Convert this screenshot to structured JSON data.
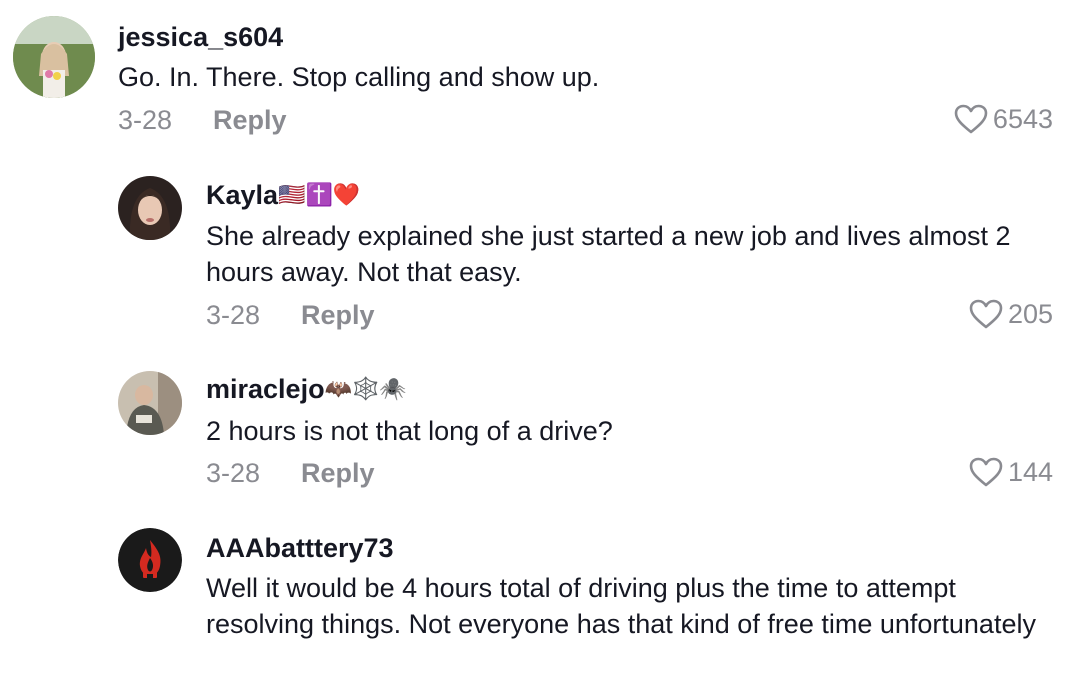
{
  "comments": [
    {
      "username": "jessica_s604",
      "emoji": "",
      "text": "Go. In. There. Stop calling and show up.",
      "date": "3-28",
      "reply_label": "Reply",
      "likes": "6543",
      "avatar_icon": "profile-photo-outdoor"
    },
    {
      "username": "Kayla",
      "emoji": "🇺🇸✝️❤️",
      "text": "She already explained she just started a new job and lives almost 2 hours away. Not that easy.",
      "date": "3-28",
      "reply_label": "Reply",
      "likes": "205",
      "avatar_icon": "profile-photo-portrait"
    },
    {
      "username": "miraclejo",
      "emoji": "🦇🕸️🕷️",
      "text": "2 hours is not that long of a drive?",
      "date": "3-28",
      "reply_label": "Reply",
      "likes": "144",
      "avatar_icon": "profile-photo-mirror"
    },
    {
      "username": "AAAbatttery73",
      "emoji": "",
      "text": "Well it would be 4 hours total of driving plus the time to attempt resolving things. Not everyone has that kind of free time unfortunately",
      "date": "",
      "reply_label": "",
      "likes": "",
      "avatar_icon": "flame-logo"
    }
  ],
  "colors": {
    "text": "#161823",
    "muted": "#8a8b91",
    "background": "#ffffff"
  }
}
